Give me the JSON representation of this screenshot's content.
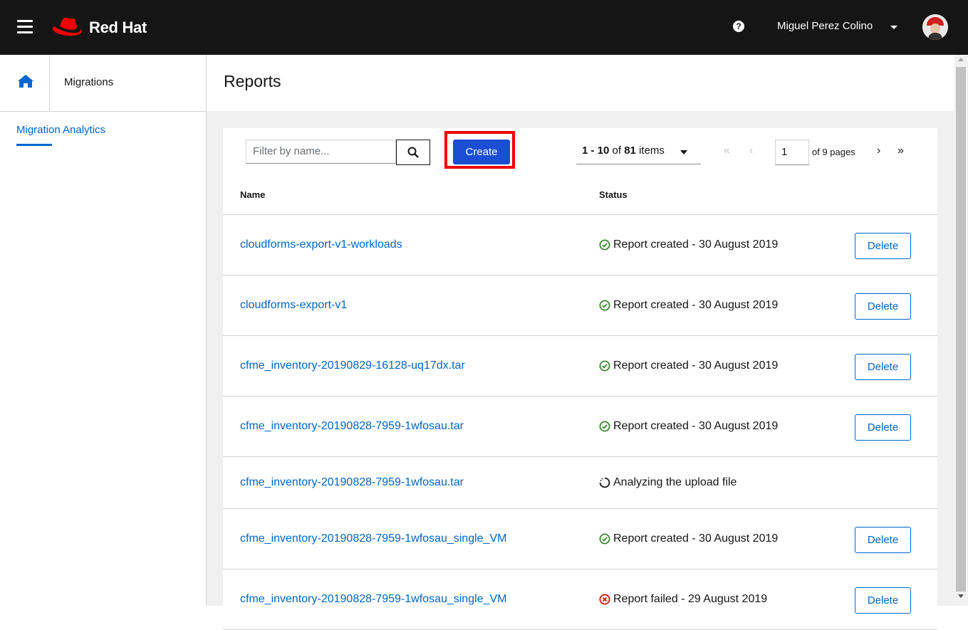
{
  "header": {
    "brand": "Red Hat",
    "user_name": "Miguel Perez Colino",
    "help_glyph": "?"
  },
  "sidebar": {
    "breadcrumb": "Migrations",
    "nav_item": "Migration Analytics"
  },
  "page": {
    "title": "Reports"
  },
  "toolbar": {
    "filter_placeholder": "Filter by name...",
    "create_label": "Create",
    "pagination": {
      "range": "1 - 10",
      "of_text": " of ",
      "total": "81",
      "items_text": " items",
      "current_page": "1",
      "pages_text": "of 9 pages"
    }
  },
  "table": {
    "headers": [
      "Name",
      "Status"
    ],
    "delete_label": "Delete",
    "rows": [
      {
        "name": "cloudforms-export-v1-workloads",
        "status": "Report created - 30 August 2019",
        "state": "success"
      },
      {
        "name": "cloudforms-export-v1",
        "status": "Report created - 30 August 2019",
        "state": "success"
      },
      {
        "name": "cfme_inventory-20190829-16128-uq17dx.tar",
        "status": "Report created - 30 August 2019",
        "state": "success"
      },
      {
        "name": "cfme_inventory-20190828-7959-1wfosau.tar",
        "status": "Report created - 30 August 2019",
        "state": "success"
      },
      {
        "name": "cfme_inventory-20190828-7959-1wfosau.tar",
        "status": "Analyzing the upload file",
        "state": "in-progress"
      },
      {
        "name": "cfme_inventory-20190828-7959-1wfosau_single_VM",
        "status": "Report created - 30 August 2019",
        "state": "success"
      },
      {
        "name": "cfme_inventory-20190828-7959-1wfosau_single_VM",
        "status": "Report failed - 29 August 2019",
        "state": "failed"
      }
    ]
  },
  "colors": {
    "accent": "#0066cc",
    "success": "#3e8635",
    "danger": "#c9190b",
    "highlight": "#ee0000"
  },
  "icons": {
    "menu": "hamburger-icon",
    "logo": "redhat-fedora-icon",
    "help": "question-circle-icon",
    "home": "home-icon",
    "search": "search-icon",
    "success": "check-circle-icon",
    "progress": "spinner-icon",
    "failed": "times-circle-icon"
  }
}
